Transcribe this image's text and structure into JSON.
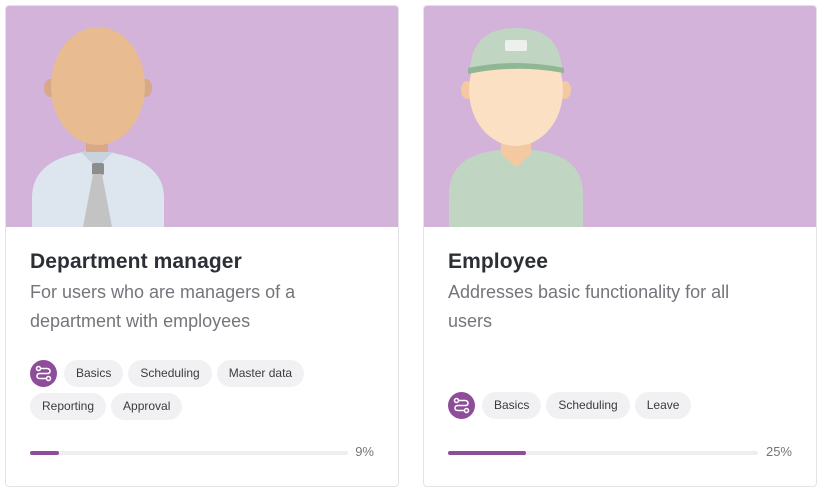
{
  "cards": [
    {
      "title": "Department manager",
      "description": "For users who are managers of a department with employees",
      "tags": [
        "Basics",
        "Scheduling",
        "Master data",
        "Reporting",
        "Approval"
      ],
      "progress_percent": 9,
      "progress_label": "9%"
    },
    {
      "title": "Employee",
      "description": "Addresses basic functionality for all users",
      "tags": [
        "Basics",
        "Scheduling",
        "Leave"
      ],
      "progress_percent": 25,
      "progress_label": "25%"
    }
  ],
  "colors": {
    "banner": "#d3b3d9",
    "accent": "#8e4d98",
    "tag_bg": "#f1f1f3"
  },
  "icons": {
    "tag_group": "route-icon"
  }
}
